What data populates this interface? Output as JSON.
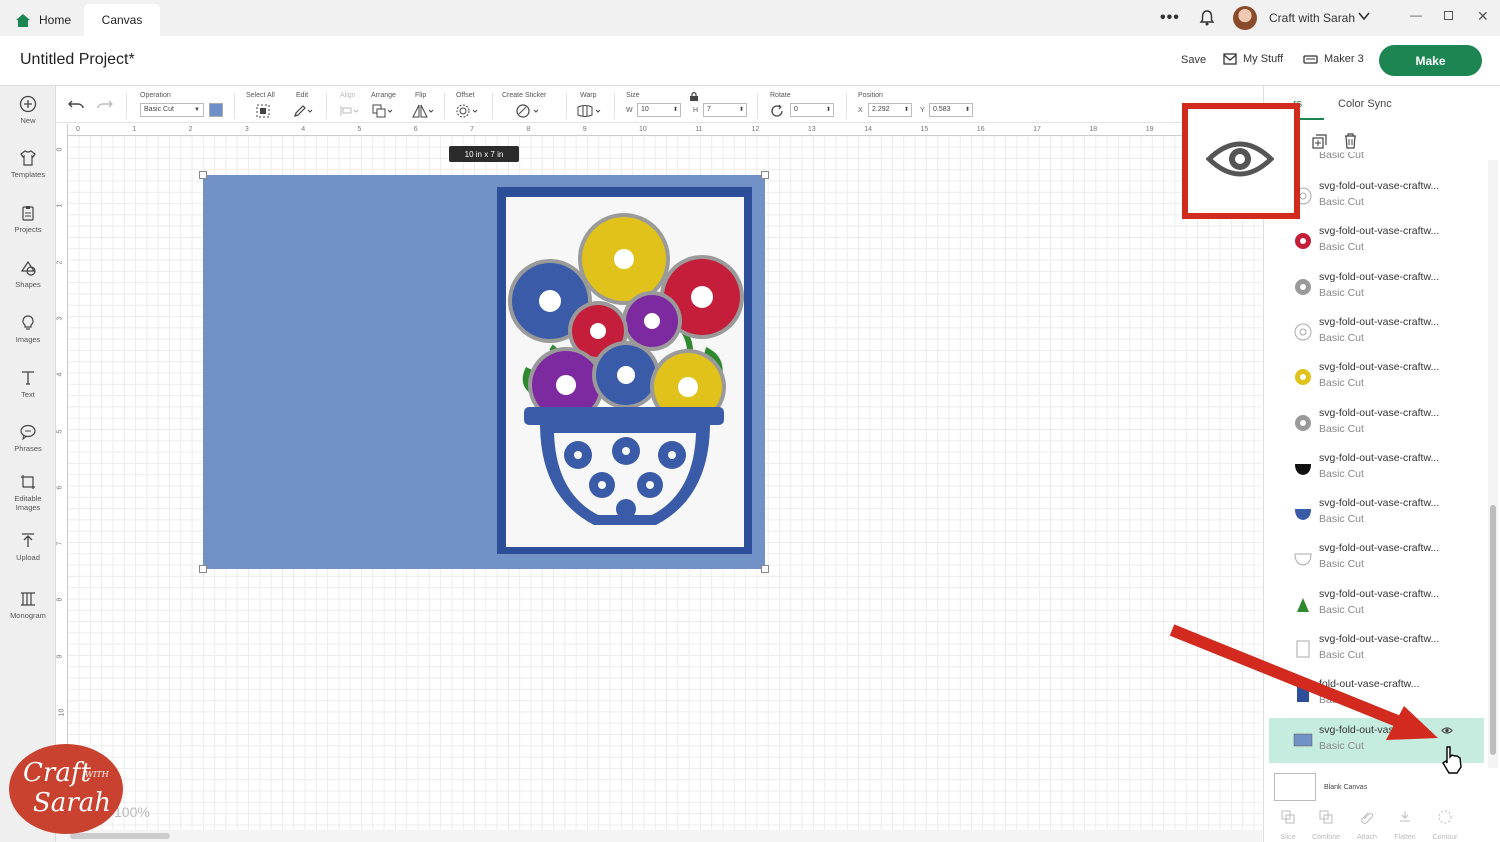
{
  "tabs": {
    "home": "Home",
    "canvas": "Canvas"
  },
  "titlebar": {
    "user_name": "Craft with Sarah",
    "more_icon": "more-dots-icon",
    "notification_icon": "bell-icon"
  },
  "header": {
    "project_title": "Untitled Project*",
    "save": "Save",
    "my_stuff": "My Stuff",
    "machine": "Maker 3",
    "make": "Make"
  },
  "toolbar": {
    "operation_label": "Operation",
    "operation_value": "Basic Cut",
    "select_all": "Select All",
    "edit": "Edit",
    "align": "Align",
    "arrange": "Arrange",
    "flip": "Flip",
    "offset": "Offset",
    "create_sticker": "Create Sticker",
    "warp": "Warp",
    "size_label": "Size",
    "w_label": "W",
    "w_value": "10",
    "h_label": "H",
    "h_value": "7",
    "rotate_label": "Rotate",
    "rotate_value": "0",
    "position_label": "Position",
    "x_label": "X",
    "x_value": "2.292",
    "y_label": "Y",
    "y_value": "0.583"
  },
  "sidebar": [
    {
      "label": "New",
      "icon": "plus-circle-icon"
    },
    {
      "label": "Templates",
      "icon": "shirt-icon"
    },
    {
      "label": "Projects",
      "icon": "clipboard-icon"
    },
    {
      "label": "Shapes",
      "icon": "shapes-icon"
    },
    {
      "label": "Images",
      "icon": "lightbulb-icon"
    },
    {
      "label": "Text",
      "icon": "text-icon"
    },
    {
      "label": "Phrases",
      "icon": "speech-bubble-icon"
    },
    {
      "label": "Editable Images",
      "icon": "editable-image-icon"
    },
    {
      "label": "Upload",
      "icon": "upload-icon"
    },
    {
      "label": "Monogram",
      "icon": "monogram-icon"
    }
  ],
  "canvas": {
    "ruler_top": [
      "0",
      "1",
      "2",
      "3",
      "4",
      "5",
      "6",
      "7",
      "8",
      "9",
      "10",
      "11",
      "12",
      "13",
      "14",
      "15",
      "16",
      "17",
      "18",
      "19"
    ],
    "ruler_left": [
      "0",
      "1",
      "2",
      "3",
      "4",
      "5",
      "6",
      "7",
      "8",
      "9",
      "10"
    ],
    "size_tooltip": "10  in x 7  in",
    "zoom": "100%"
  },
  "layers_panel": {
    "tab_layers": "Layers",
    "tab_layers_visible": "rs",
    "tab_color_sync": "Color Sync",
    "partial_top_op": "Basic Cut",
    "items": [
      {
        "name": "svg-fold-out-vase-craftw...",
        "op": "Basic Cut",
        "color": "#ffffff",
        "shape": "flower-outline"
      },
      {
        "name": "svg-fold-out-vase-craftw...",
        "op": "Basic Cut",
        "color": "#c41e3a",
        "shape": "flower"
      },
      {
        "name": "svg-fold-out-vase-craftw...",
        "op": "Basic Cut",
        "color": "#9a9a9a",
        "shape": "flower"
      },
      {
        "name": "svg-fold-out-vase-craftw...",
        "op": "Basic Cut",
        "color": "#ffffff",
        "shape": "flower-outline"
      },
      {
        "name": "svg-fold-out-vase-craftw...",
        "op": "Basic Cut",
        "color": "#e0c21a",
        "shape": "flower"
      },
      {
        "name": "svg-fold-out-vase-craftw...",
        "op": "Basic Cut",
        "color": "#9a9a9a",
        "shape": "flower"
      },
      {
        "name": "svg-fold-out-vase-craftw...",
        "op": "Basic Cut",
        "color": "#111111",
        "shape": "bowl"
      },
      {
        "name": "svg-fold-out-vase-craftw...",
        "op": "Basic Cut",
        "color": "#3a5ba8",
        "shape": "bowl"
      },
      {
        "name": "svg-fold-out-vase-craftw...",
        "op": "Basic Cut",
        "color": "#ffffff",
        "shape": "bowl-outline"
      },
      {
        "name": "svg-fold-out-vase-craftw...",
        "op": "Basic Cut",
        "color": "#2f8a2f",
        "shape": "leaves"
      },
      {
        "name": "svg-fold-out-vase-craftw...",
        "op": "Basic Cut",
        "color": "#ffffff",
        "shape": "rect-outline"
      },
      {
        "name": "fold-out-vase-craftw...",
        "op": "Basic",
        "color": "#2d4f9a",
        "shape": "rect-tall"
      },
      {
        "name": "svg-fold-out-vase-cr...",
        "op": "Basic Cut",
        "color": "#7191c7",
        "shape": "rect-wide",
        "selected": true
      }
    ],
    "blank_canvas": "Blank Canvas",
    "bottom_tools": [
      "Slice",
      "Combine",
      "Attach",
      "Flatten",
      "Contour"
    ]
  },
  "overlay": {
    "logo_line1": "Craft",
    "logo_with": "WITH",
    "logo_line2": "Sarah"
  },
  "colors": {
    "brand_green": "#1c8551",
    "highlight_red": "#d22a1f",
    "card_blue": "#7191c7",
    "frame_blue": "#2d4f9a",
    "selected_row": "#c6ece0"
  }
}
